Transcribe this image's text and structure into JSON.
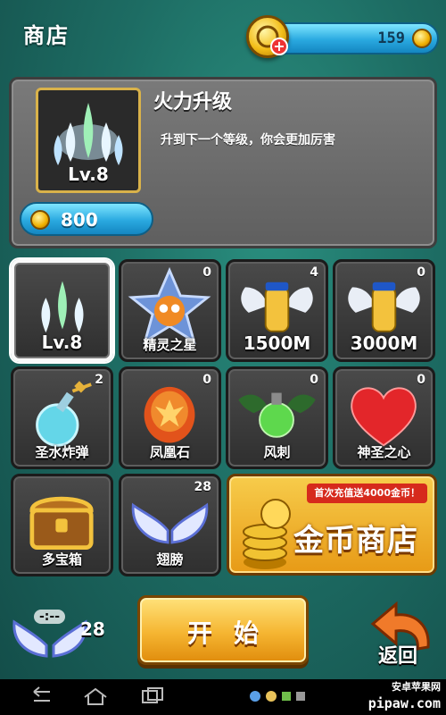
{
  "header": {
    "title": "商店",
    "coins": "159"
  },
  "upgrade": {
    "title": "火力升级",
    "description": "升到下一个等级，你会更加厉害",
    "level": "Lv.8",
    "price": "800"
  },
  "items": [
    {
      "label": "Lv.8",
      "count": "",
      "icon": "ship-fire-icon",
      "selected": true
    },
    {
      "label": "精灵之星",
      "count": "0",
      "icon": "spirit-star-icon"
    },
    {
      "label": "1500M",
      "count": "4",
      "icon": "winged-capsule-icon"
    },
    {
      "label": "3000M",
      "count": "0",
      "icon": "winged-capsule-icon"
    },
    {
      "label": "圣水炸弹",
      "count": "2",
      "icon": "holy-water-bomb-icon"
    },
    {
      "label": "凤凰石",
      "count": "0",
      "icon": "phoenix-stone-icon"
    },
    {
      "label": "风刺",
      "count": "0",
      "icon": "wind-sting-icon"
    },
    {
      "label": "神圣之心",
      "count": "0",
      "icon": "holy-heart-icon"
    },
    {
      "label": "多宝箱",
      "count": "",
      "icon": "treasure-chest-icon"
    },
    {
      "label": "翅膀",
      "count": "28",
      "icon": "wings-icon"
    }
  ],
  "coin_shop": {
    "promo": "首次充值送4000金币！",
    "label": "金币商店"
  },
  "footer": {
    "timer": "-:--",
    "wings_count": "28",
    "start_label": "开始",
    "back_label": "返回"
  },
  "watermark": {
    "top": "安卓苹果网",
    "bottom": "pipaw.com"
  }
}
